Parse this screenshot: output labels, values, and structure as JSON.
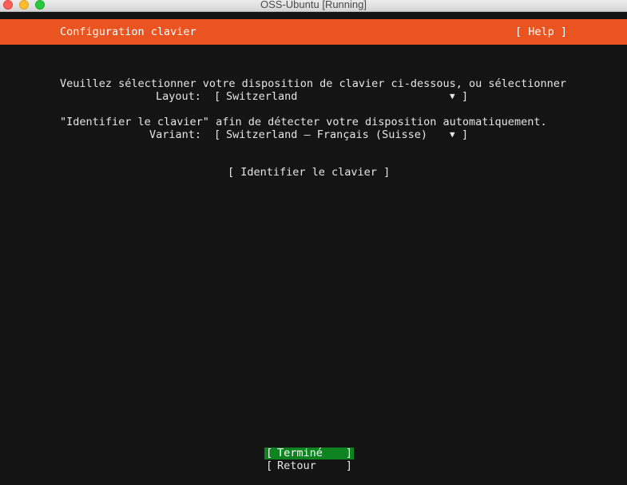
{
  "window": {
    "title": "OSS-Ubuntu [Running]"
  },
  "header": {
    "title": "Configuration clavier",
    "help_label": "[ Help ]"
  },
  "intro": {
    "line1": "Veuillez sélectionner votre disposition de clavier ci-dessous, ou sélectionner",
    "line2": "\"Identifier le clavier\" afin de détecter votre disposition automatiquement."
  },
  "layout": {
    "label": "Layout:",
    "value": "Switzerland",
    "open_bracket": "[",
    "close_bracket": "]",
    "arrow": "▼"
  },
  "variant": {
    "label": "Variant:",
    "value": "Switzerland – Français (Suisse)",
    "open_bracket": "[",
    "close_bracket": "]",
    "arrow": "▼"
  },
  "identify_button": {
    "label": "[ Identifier le clavier ]"
  },
  "footer": {
    "done": {
      "open_bracket": "[",
      "label": "Terminé",
      "close_bracket": "]"
    },
    "back": {
      "open_bracket": "[",
      "label": "Retour",
      "close_bracket": "]"
    }
  },
  "colors": {
    "header_bg": "#e95420",
    "done_bg": "#0e8420",
    "background": "#141414"
  }
}
